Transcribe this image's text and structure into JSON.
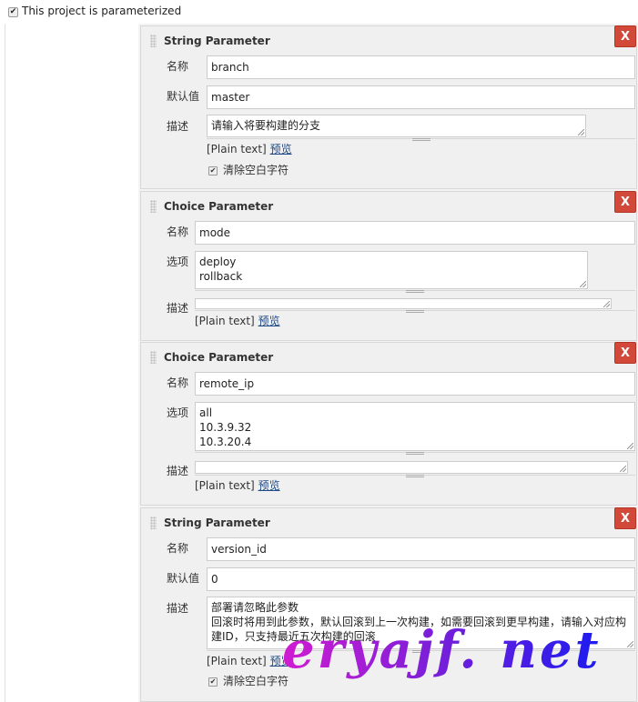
{
  "top": {
    "checkbox_mark": "✔",
    "label": "This project is parameterized"
  },
  "blocks": [
    {
      "title": "String Parameter",
      "delete": "X",
      "name_label": "名称",
      "name_value": "branch",
      "default_label": "默认值",
      "default_value": "master",
      "desc_label": "描述",
      "desc_value": "请输入将要构建的分支",
      "plain_text": "[Plain text]",
      "preview": "预览",
      "trim_label": "清除空白字符"
    },
    {
      "title": "Choice Parameter",
      "delete": "X",
      "name_label": "名称",
      "name_value": "mode",
      "choices_label": "选项",
      "choices": [
        "deploy",
        "rollback"
      ],
      "desc_label": "描述",
      "desc_value": "",
      "plain_text": "[Plain text]",
      "preview": "预览"
    },
    {
      "title": "Choice Parameter",
      "delete": "X",
      "name_label": "名称",
      "name_value": "remote_ip",
      "choices_label": "选项",
      "choices": [
        "all",
        "10.3.9.32",
        "10.3.20.4"
      ],
      "desc_label": "描述",
      "desc_value": "",
      "plain_text": "[Plain text]",
      "preview": "预览"
    },
    {
      "title": "String Parameter",
      "delete": "X",
      "name_label": "名称",
      "name_value": "version_id",
      "default_label": "默认值",
      "default_value": "0",
      "desc_label": "描述",
      "desc_lines": [
        "部署请忽略此参数",
        "回滚时将用到此参数，默认回滚到上一次构建，如需要回滚到更早构建，请输入对应构",
        "建ID，只支持最近五次构建的回滚"
      ],
      "plain_text": "[Plain text]",
      "preview": "预览",
      "trim_label": "清除空白字符"
    }
  ],
  "watermark": "eryajf. net",
  "colors": {
    "delete_button": "#d24939",
    "link": "#204a87",
    "panel_bg": "#f0f0f0"
  }
}
